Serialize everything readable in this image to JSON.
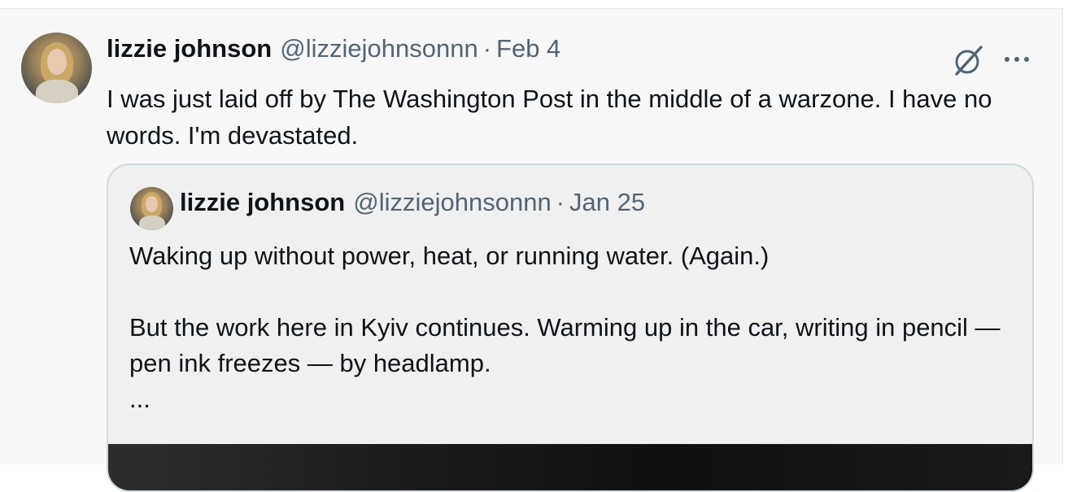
{
  "tweet": {
    "author_name": "lizzie johnson",
    "handle": "@lizziejohnsonnn",
    "separator": "·",
    "date": "Feb 4",
    "text": "I was just laid off by The Washington Post in the middle of a warzone. I have no words. I'm devastated.",
    "icons": {
      "grok": "grok-icon",
      "more": "more-options-icon"
    }
  },
  "quoted_tweet": {
    "author_name": "lizzie johnson",
    "handle": "@lizziejohnsonnn",
    "separator": "·",
    "date": "Jan 25",
    "line_1": "Waking up without power, heat, or running water. (Again.)",
    "line_2": "But the work here in Kyiv continues. Warming up in the car, writing in pencil — pen ink freezes — by headlamp.",
    "truncation": "..."
  },
  "colors": {
    "text_primary": "#0f1419",
    "text_secondary": "#536471",
    "border": "#cfd9de",
    "background": "#f7f7f7"
  }
}
